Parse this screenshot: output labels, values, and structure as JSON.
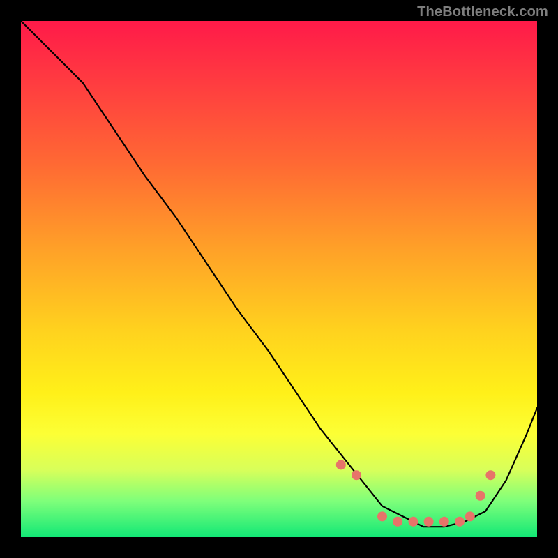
{
  "watermark": "TheBottleneck.com",
  "colors": {
    "background": "#000000",
    "curve": "#000000",
    "marker": "#e77469",
    "gradient_top": "#ff1a49",
    "gradient_bottom": "#12e876"
  },
  "chart_data": {
    "type": "line",
    "title": "",
    "xlabel": "",
    "ylabel": "",
    "xlim": [
      0,
      100
    ],
    "ylim": [
      0,
      100
    ],
    "x": [
      0,
      6,
      12,
      18,
      24,
      30,
      36,
      42,
      48,
      54,
      58,
      62,
      66,
      70,
      74,
      78,
      82,
      86,
      90,
      94,
      98,
      100
    ],
    "y": [
      100,
      94,
      88,
      79,
      70,
      62,
      53,
      44,
      36,
      27,
      21,
      16,
      11,
      6,
      4,
      2,
      2,
      3,
      5,
      11,
      20,
      25
    ],
    "markers": {
      "x": [
        62,
        65,
        70,
        73,
        76,
        79,
        82,
        85,
        87,
        89,
        91
      ],
      "y": [
        14,
        12,
        4,
        3,
        3,
        3,
        3,
        3,
        4,
        8,
        12
      ]
    }
  }
}
